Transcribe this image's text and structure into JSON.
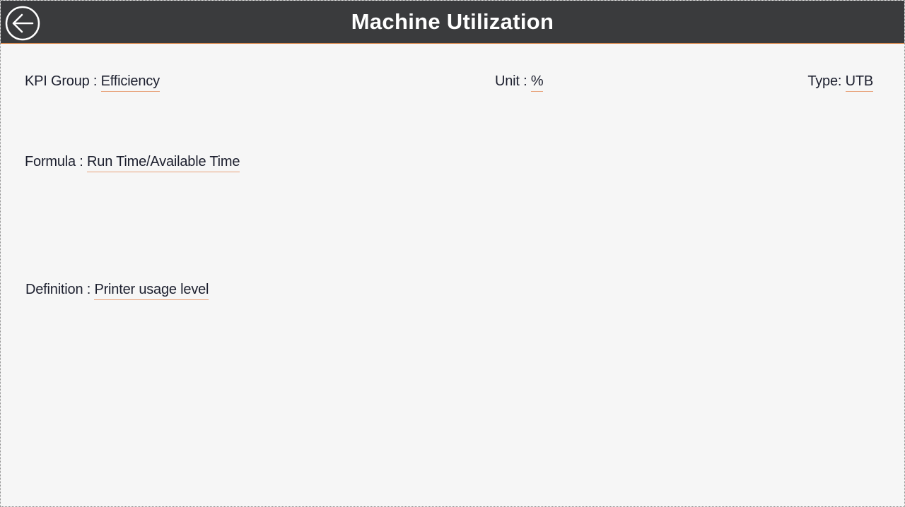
{
  "header": {
    "title": "Machine Utilization",
    "back_icon": "arrow-left-circle-icon"
  },
  "kpi": {
    "group_label": "KPI Group : ",
    "group_value": "Efficiency",
    "unit_label": "Unit : ",
    "unit_value": "%",
    "type_label": "Type: ",
    "type_value": "UTB",
    "formula_label": "Formula : ",
    "formula_value": "Run Time/Available Time",
    "definition_label": "Definition : ",
    "definition_value": "Printer usage level"
  },
  "colors": {
    "header_bg": "#3a3b3d",
    "accent_underline": "#e8a27a",
    "page_bg": "#f6f6f6"
  }
}
